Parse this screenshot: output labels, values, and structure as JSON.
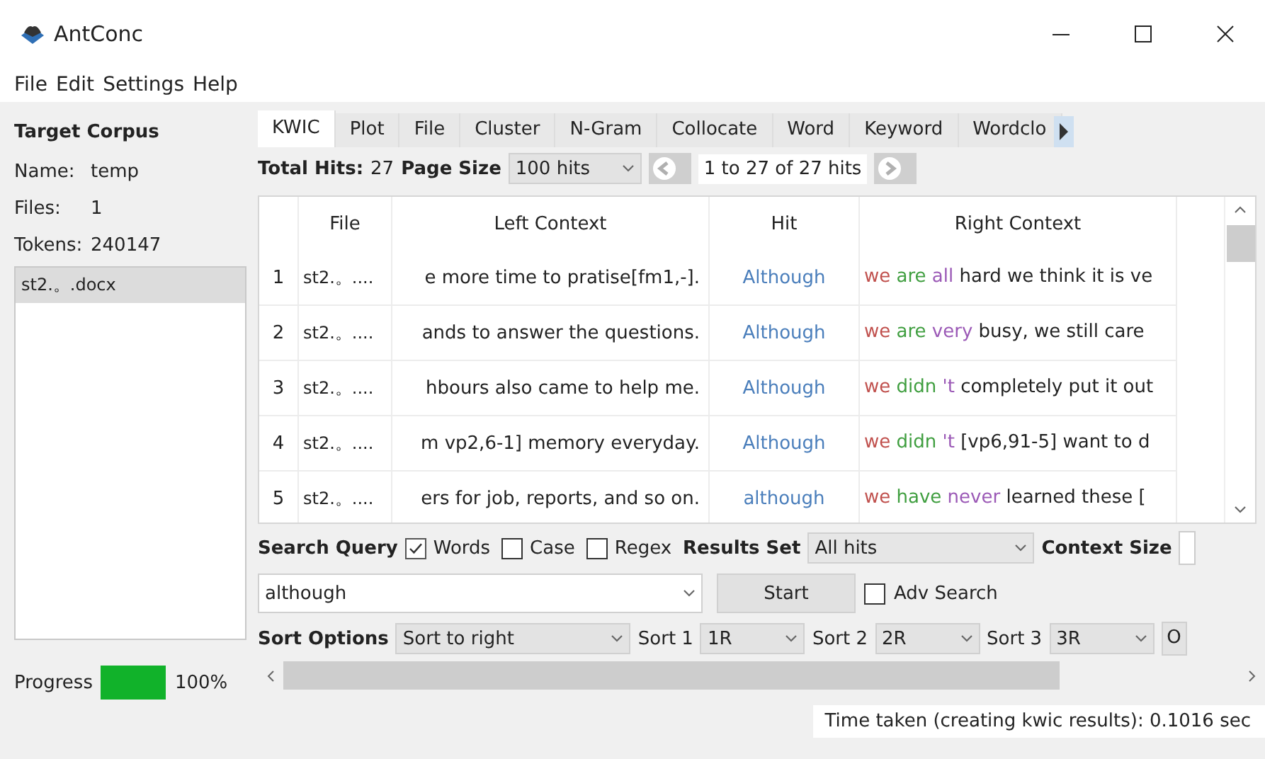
{
  "window": {
    "title": "AntConc"
  },
  "menu": [
    "File",
    "Edit",
    "Settings",
    "Help"
  ],
  "corpus": {
    "title": "Target Corpus",
    "fields": [
      {
        "label": "Name:",
        "value": "temp"
      },
      {
        "label": "Files:",
        "value": "1"
      },
      {
        "label": "Tokens:",
        "value": "240147"
      }
    ],
    "files": [
      {
        "name": "st2.。.docx",
        "selected": true
      }
    ],
    "progress": {
      "label": "Progress",
      "level": 1,
      "reading": "100%"
    }
  },
  "tabs": [
    {
      "label": "KWIC",
      "selected": true
    },
    {
      "label": "Plot",
      "selected": false
    },
    {
      "label": "File",
      "selected": false
    },
    {
      "label": "Cluster",
      "selected": false
    },
    {
      "label": "N-Gram",
      "selected": false
    },
    {
      "label": "Collocate",
      "selected": false
    },
    {
      "label": "Word",
      "selected": false
    },
    {
      "label": "Keyword",
      "selected": false
    },
    {
      "label": "Wordclo",
      "selected": false
    }
  ],
  "hits_bar": {
    "total_label": "Total Hits:",
    "total": "27",
    "page_size_label": "Page Size",
    "page_size": "100 hits",
    "range": "1 to 27 of 27 hits"
  },
  "table": {
    "columns": [
      "",
      "File",
      "Left Context",
      "Hit",
      "Right Context"
    ],
    "rows": [
      {
        "index": "1",
        "file": "st2.。....",
        "left": "e more time to pratise[fm1,-].",
        "hit": "Although",
        "right": [
          {
            "text": "we",
            "color": "#c0504d"
          },
          {
            "text": "are",
            "color": "#3f9e3f"
          },
          {
            "text": "all",
            "color": "#9b59b6"
          },
          {
            "text": "hard we think it is ve",
            "color": "#222222"
          }
        ]
      },
      {
        "index": "2",
        "file": "st2.。....",
        "left": "ands to answer the questions.",
        "hit": "Although",
        "right": [
          {
            "text": "we",
            "color": "#c0504d"
          },
          {
            "text": "are",
            "color": "#3f9e3f"
          },
          {
            "text": "very",
            "color": "#9b59b6"
          },
          {
            "text": "busy, we still care",
            "color": "#222222"
          }
        ]
      },
      {
        "index": "3",
        "file": "st2.。....",
        "left": "hbours also came to help me.",
        "hit": "Although",
        "right": [
          {
            "text": "we",
            "color": "#c0504d"
          },
          {
            "text": "didn",
            "color": "#3f9e3f"
          },
          {
            "text": "'t",
            "color": "#9b59b6"
          },
          {
            "text": "completely put it out",
            "color": "#222222"
          }
        ]
      },
      {
        "index": "4",
        "file": "st2.。....",
        "left": "m vp2,6-1] memory everyday.",
        "hit": "Although",
        "right": [
          {
            "text": "we",
            "color": "#c0504d"
          },
          {
            "text": "didn",
            "color": "#3f9e3f"
          },
          {
            "text": "'t",
            "color": "#9b59b6"
          },
          {
            "text": "[vp6,91-5] want to d",
            "color": "#222222"
          }
        ]
      },
      {
        "index": "5",
        "file": "st2.。....",
        "left": "ers for job, reports, and so on.",
        "hit": "although",
        "right": [
          {
            "text": "we",
            "color": "#c0504d"
          },
          {
            "text": "have",
            "color": "#3f9e3f"
          },
          {
            "text": "never",
            "color": "#9b59b6"
          },
          {
            "text": "learned these [",
            "color": "#222222"
          }
        ]
      }
    ]
  },
  "search": {
    "label": "Search Query",
    "options": [
      {
        "label": "Words",
        "checked": true
      },
      {
        "label": "Case",
        "checked": false
      },
      {
        "label": "Regex",
        "checked": false
      }
    ],
    "results_label": "Results Set",
    "results": "All hits",
    "context_label": "Context Size",
    "query": "although",
    "start": "Start",
    "adv": {
      "label": "Adv Search",
      "checked": false
    }
  },
  "sort": {
    "label": "Sort Options",
    "mode": "Sort to right",
    "levels": [
      {
        "label": "Sort 1",
        "value": "1R"
      },
      {
        "label": "Sort 2",
        "value": "2R"
      },
      {
        "label": "Sort 3",
        "value": "3R"
      }
    ],
    "more": "O"
  },
  "status": "Time taken (creating kwic results):  0.1016 sec"
}
